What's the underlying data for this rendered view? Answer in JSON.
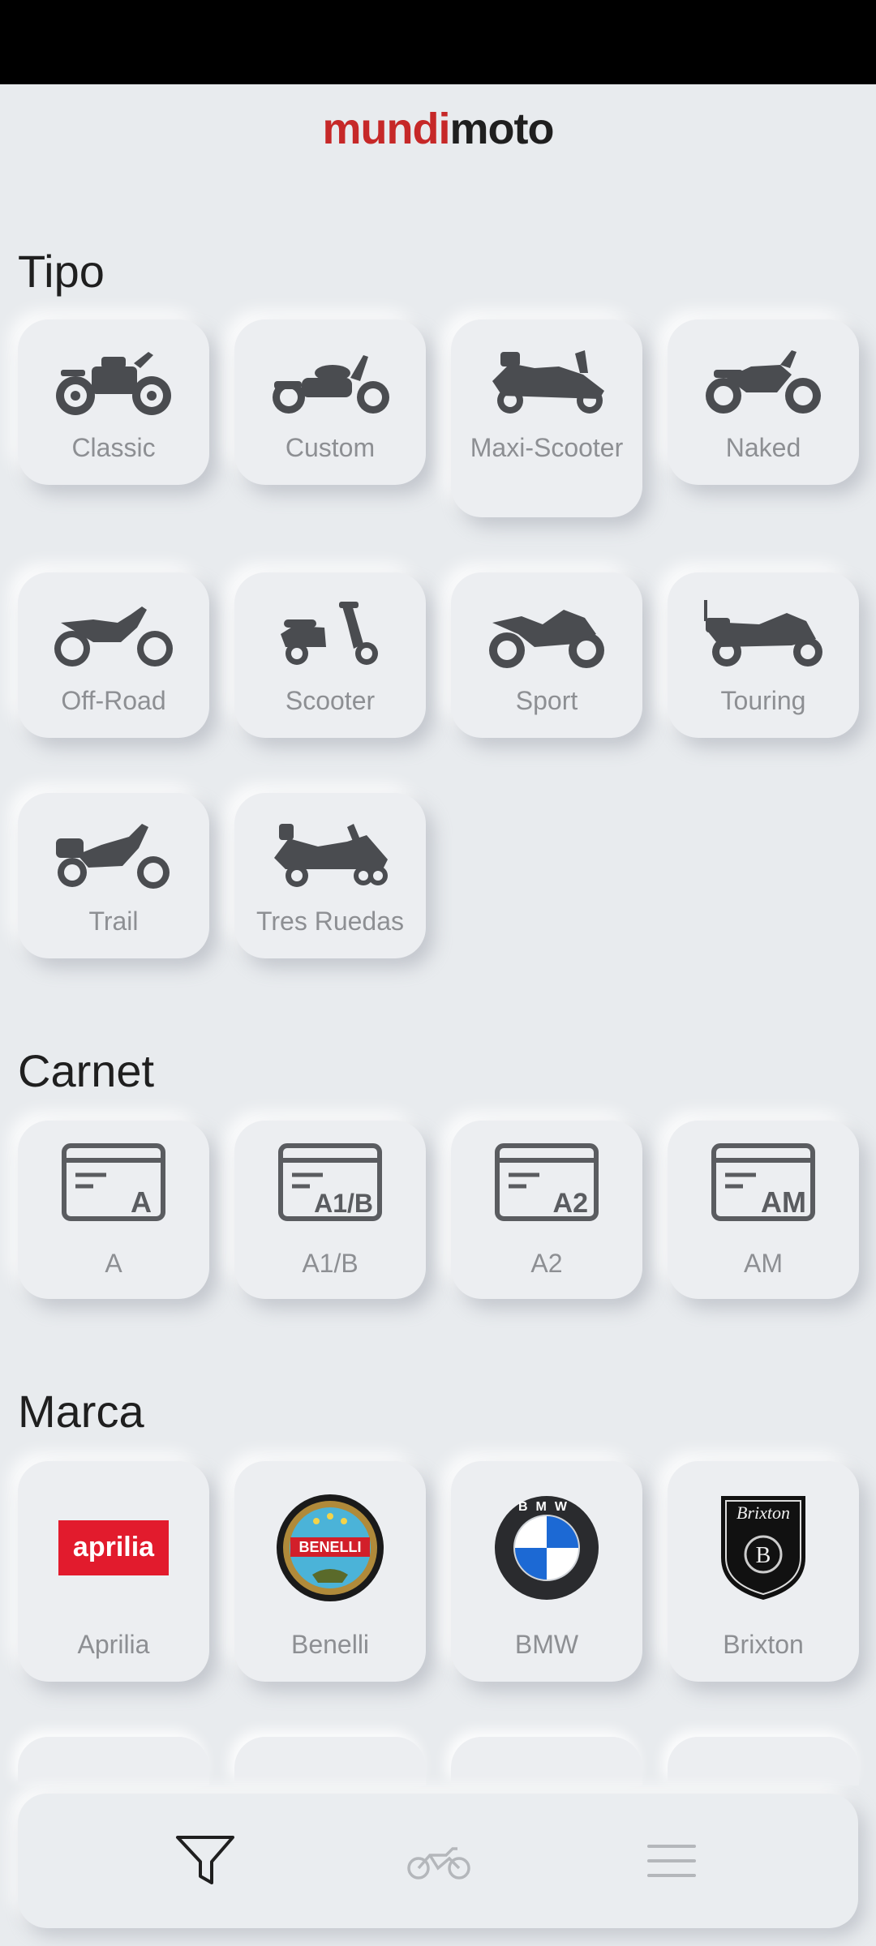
{
  "app": {
    "logo_part1": "mundi",
    "logo_part2": "moto"
  },
  "sections": {
    "tipo": {
      "title": "Tipo",
      "items": [
        {
          "label": "Classic",
          "icon": "classic-motorcycle-icon"
        },
        {
          "label": "Custom",
          "icon": "custom-motorcycle-icon"
        },
        {
          "label": "Maxi-Scooter",
          "icon": "maxi-scooter-icon"
        },
        {
          "label": "Naked",
          "icon": "naked-motorcycle-icon"
        },
        {
          "label": "Off-Road",
          "icon": "offroad-motorcycle-icon"
        },
        {
          "label": "Scooter",
          "icon": "scooter-icon"
        },
        {
          "label": "Sport",
          "icon": "sport-motorcycle-icon"
        },
        {
          "label": "Touring",
          "icon": "touring-motorcycle-icon"
        },
        {
          "label": "Trail",
          "icon": "trail-motorcycle-icon"
        },
        {
          "label": "Tres Ruedas",
          "icon": "three-wheel-motorcycle-icon"
        }
      ]
    },
    "carnet": {
      "title": "Carnet",
      "items": [
        {
          "label": "A",
          "card_text": "A",
          "icon": "license-card-icon"
        },
        {
          "label": "A1/B",
          "card_text": "A1/B",
          "icon": "license-card-icon"
        },
        {
          "label": "A2",
          "card_text": "A2",
          "icon": "license-card-icon"
        },
        {
          "label": "AM",
          "card_text": "AM",
          "icon": "license-card-icon"
        }
      ]
    },
    "marca": {
      "title": "Marca",
      "items": [
        {
          "label": "Aprilia",
          "logo_text": "aprilia",
          "icon": "aprilia-logo"
        },
        {
          "label": "Benelli",
          "logo_text": "BENELLI",
          "icon": "benelli-logo"
        },
        {
          "label": "BMW",
          "logo_text": "BMW",
          "icon": "bmw-logo"
        },
        {
          "label": "Brixton",
          "logo_text": "Brixton",
          "icon": "brixton-logo"
        }
      ]
    }
  },
  "nav": {
    "items": [
      {
        "icon": "filter-icon",
        "active": true
      },
      {
        "icon": "motorcycle-icon",
        "active": false
      },
      {
        "icon": "menu-icon",
        "active": false
      }
    ]
  },
  "colors": {
    "accent": "#c62828",
    "background": "#e8ebee",
    "label": "#8d8f93",
    "icon": "#4a4c50"
  }
}
